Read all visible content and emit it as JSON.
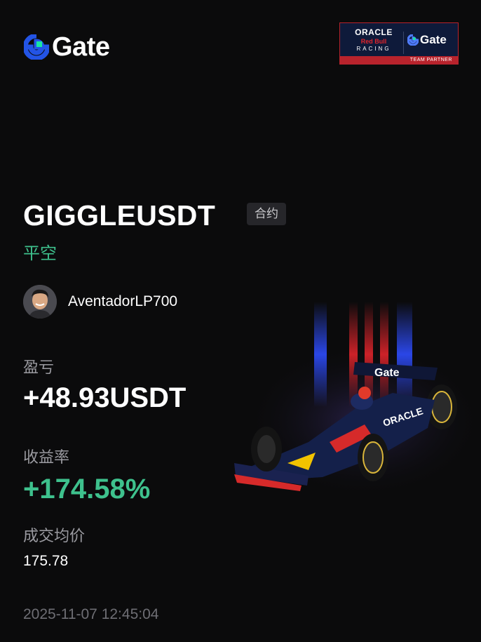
{
  "brand": {
    "logo_text": "Gate"
  },
  "partner_badge": {
    "oracle": "ORACLE",
    "redbull": "Red Bull",
    "racing": "RACING",
    "gate": "Gate",
    "team_partner": "TEAM PARTNER"
  },
  "trade": {
    "pair": "GIGGLEUSDT",
    "type_tag": "合约",
    "direction": "平空"
  },
  "user": {
    "name": "AventadorLP700"
  },
  "stats": {
    "pnl_label": "盈亏",
    "pnl_value": "+48.93USDT",
    "roi_label": "收益率",
    "roi_value": "+174.58%",
    "avg_label": "成交均价",
    "avg_value": "175.78"
  },
  "timestamp": "2025-11-07 12:45:04",
  "colors": {
    "background": "#0b0b0c",
    "accent_green": "#3ec18d",
    "brand_blue": "#2354e6",
    "brand_teal": "#17e6a1"
  }
}
